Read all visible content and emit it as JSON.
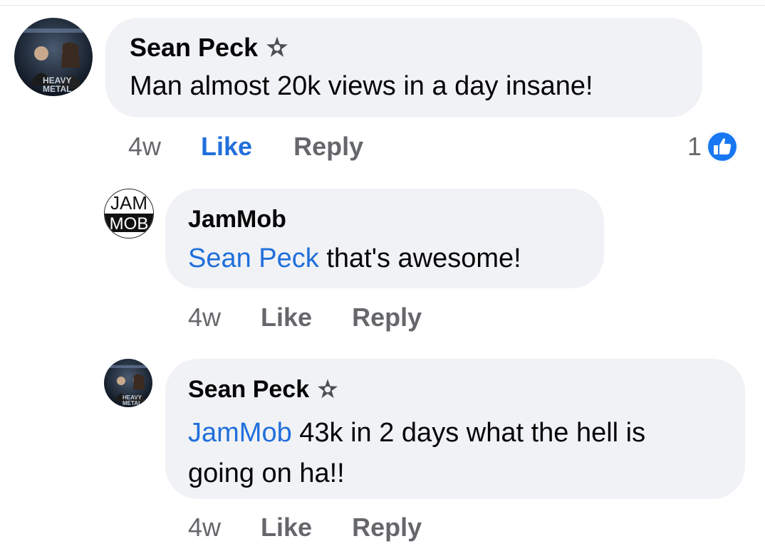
{
  "comments": [
    {
      "author": "Sean Peck",
      "avatar_icon": "metal-band-avatar",
      "badge_icon": "top-fan-badge-icon",
      "mention": "",
      "text": "Man almost 20k views in a day insane!",
      "time": "4w",
      "like_label": "Like",
      "reply_label": "Reply",
      "liked": true,
      "reaction_count": "1",
      "reaction_icon": "thumbs-up-icon"
    },
    {
      "author": "JamMob",
      "avatar_icon": "jammob-logo-avatar",
      "avatar_text_top": "JAM",
      "avatar_text_bottom": "MOB",
      "mention": "Sean Peck",
      "text": " that's awesome!",
      "time": "4w",
      "like_label": "Like",
      "reply_label": "Reply"
    },
    {
      "author": "Sean Peck",
      "avatar_icon": "metal-band-avatar",
      "badge_icon": "top-fan-badge-icon",
      "mention": "JamMob",
      "text": " 43k in 2 days what the hell is going on ha!!",
      "time": "4w",
      "like_label": "Like",
      "reply_label": "Reply"
    }
  ],
  "colors": {
    "bubble": "#f0f2f5",
    "link_blue": "#216fdb",
    "secondary_text": "#65676b",
    "like_blue": "#1877f2"
  }
}
